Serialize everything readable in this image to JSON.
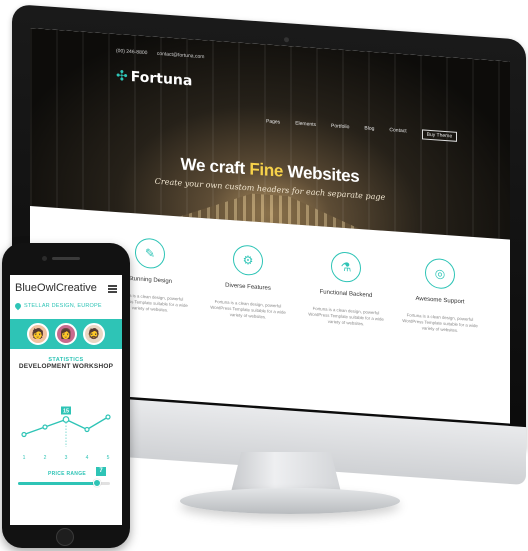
{
  "desktop_site": {
    "topbar": {
      "phone": "(00) 246-8800",
      "email": "contact@fortuna.com"
    },
    "logo": "Fortuna",
    "nav": [
      "Pages",
      "Elements",
      "Portfolio",
      "Blog",
      "Contact",
      "Buy Theme"
    ],
    "headline": {
      "prefix": "We craft",
      "accent": "Fine",
      "suffix": "Websites"
    },
    "subline": "Create your own custom headers for each separate page",
    "accent_color": "#2ec4b6",
    "features": [
      {
        "icon": "pencil-ruler-icon",
        "title": "Stunning Design",
        "desc": "Fortuna is a clean design, powerful WordPress Template suitable for a wide variety of websites."
      },
      {
        "icon": "gear-atom-icon",
        "title": "Diverse Features",
        "desc": "Fortuna is a clean design, powerful WordPress Template suitable for a wide variety of websites."
      },
      {
        "icon": "flask-icon",
        "title": "Functional Backend",
        "desc": "Fortuna is a clean design, powerful WordPress Template suitable for a wide variety of websites."
      },
      {
        "icon": "lifebuoy-icon",
        "title": "Awesome Support",
        "desc": "Fortuna is a clean design, powerful WordPress Template suitable for a wide variety of websites."
      }
    ]
  },
  "mobile_site": {
    "brand": "BlueOwlCreative",
    "location": "STELLAR DESIGN, EUROPE",
    "team_avatars": [
      "avatar-woman-glasses",
      "avatar-woman-dark-hair",
      "avatar-man-beard"
    ],
    "stats_label": "STATISTICS",
    "stats_title": "DEVELOPMENT WORKSHOP",
    "chart_x_labels": [
      "1",
      "2",
      "3",
      "4",
      "5"
    ],
    "price_range_label": "PRICE RANGE",
    "price_badge": "7",
    "price_fraction": 0.86
  },
  "chart_data": {
    "type": "line",
    "x": [
      1,
      2,
      3,
      4,
      5
    ],
    "values": [
      5,
      8,
      11,
      7,
      12
    ],
    "highlight": {
      "x": 3,
      "label": "15"
    },
    "ylim": [
      0,
      16
    ],
    "grid": false
  }
}
